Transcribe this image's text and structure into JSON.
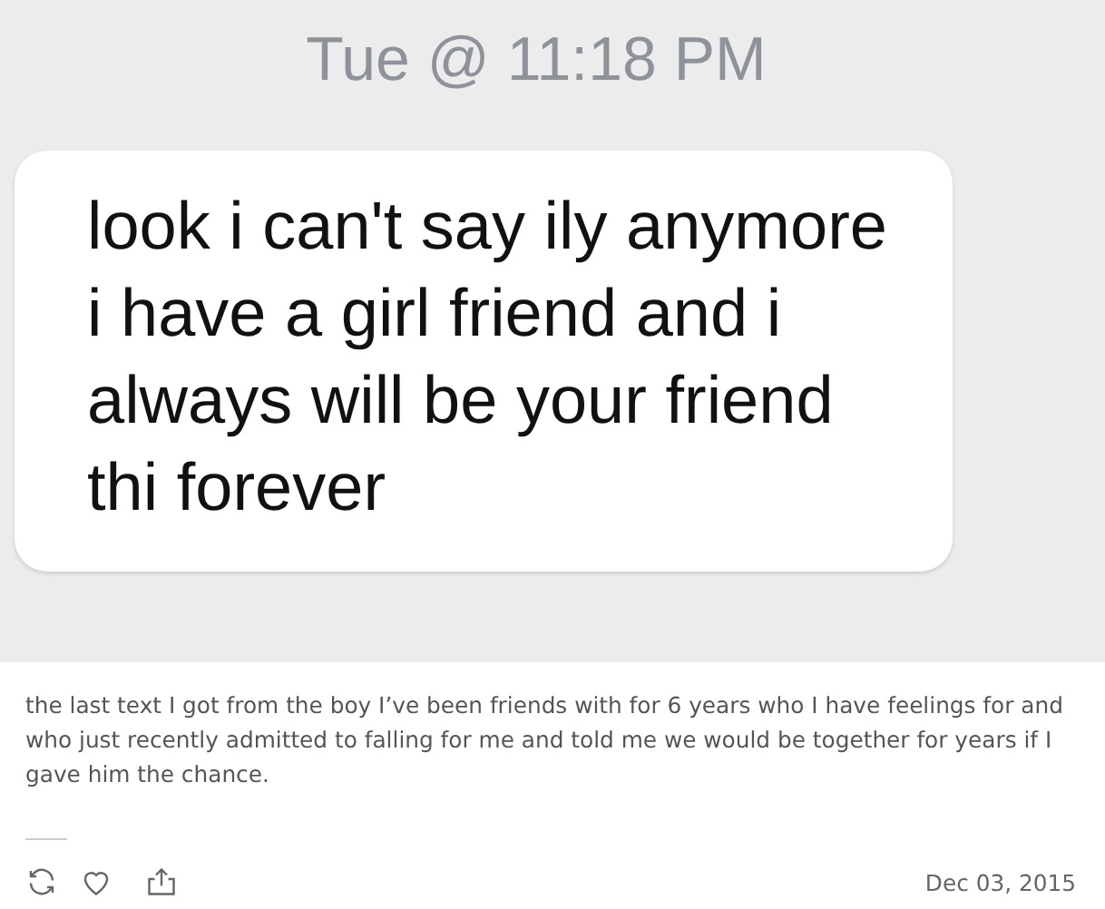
{
  "screenshot": {
    "timestamp": "Tue @ 11:18 PM",
    "message": "look i can't say ily anymore i have a girl friend and i always will be your friend thi forever"
  },
  "caption": "the last text I got from the boy I’ve been friends with for 6 years who I have feelings for and who just recently admitted to falling for me and told me we would be together for years if I gave him the chance.",
  "footer": {
    "liked": false,
    "date": "Dec 03, 2015"
  }
}
